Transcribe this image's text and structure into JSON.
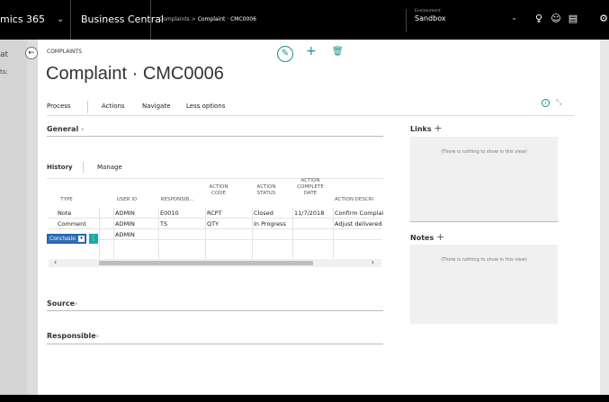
{
  "topbar": {
    "app_name": "mics 365",
    "product": "Business Central",
    "breadcrumb_parent": "Complaints",
    "breadcrumb_sep": ">",
    "breadcrumb_current": "Complaint · CMC0006",
    "env_label": "Environment",
    "env_value": "Sandbox"
  },
  "background_left": {
    "text1": "at",
    "text2": "ts:"
  },
  "page": {
    "caption": "COMPLAINTS",
    "title": "Complaint · CMC0006",
    "menu": [
      "Process",
      "Actions",
      "Navigate",
      "Less options"
    ]
  },
  "sections": {
    "general": "General",
    "source": "Source",
    "responsible": "Responsible"
  },
  "history": {
    "tabs": [
      "History",
      "Manage"
    ],
    "columns": [
      "TYPE",
      "USER ID",
      "RESPONSIB...",
      "ACTION CODE",
      "ACTION STATUS",
      "ACTION COMPLETE DATE",
      "ACTION DESCRI"
    ],
    "rows": [
      [
        "Note",
        "ADMIN",
        "E0010",
        "RCPT",
        "Closed",
        "11/7/2018",
        "Confirm Complai"
      ],
      [
        "Comment",
        "ADMIN",
        "TS",
        "QTY",
        "In Progress",
        "",
        "Adjust delivered"
      ],
      [
        "",
        "ADMIN",
        "",
        "",
        "",
        "",
        ""
      ]
    ],
    "new_row_type": "Conclusio"
  },
  "factbox": {
    "links_title": "Links",
    "links_empty": "(There is nothing to show in this view)",
    "notes_title": "Notes",
    "notes_empty": "(There is nothing to show in this view)"
  },
  "colors": {
    "accent": "#1a8f8f",
    "topbar": "#000000"
  }
}
